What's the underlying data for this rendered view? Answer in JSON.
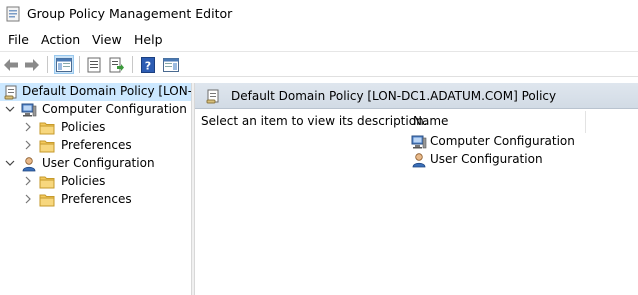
{
  "window": {
    "title": "Group Policy Management Editor",
    "icon": "gpo-editor-icon"
  },
  "menu": [
    "File",
    "Action",
    "View",
    "Help"
  ],
  "toolbar": {
    "buttons": [
      "back-arrow-icon",
      "forward-arrow-icon",
      "show-hide-console-tree-icon",
      "properties-icon",
      "export-list-icon",
      "help-icon",
      "show-hide-action-pane-icon"
    ]
  },
  "tree": {
    "root": "Default Domain Policy [LON-DC",
    "computer": {
      "label": "Computer Configuration",
      "children": [
        "Policies",
        "Preferences"
      ]
    },
    "user": {
      "label": "User Configuration",
      "children": [
        "Policies",
        "Preferences"
      ]
    }
  },
  "details": {
    "header": "Default Domain Policy [LON-DC1.ADATUM.COM] Policy",
    "description": "Select an item to view its description.",
    "column_name": "Name",
    "items": [
      "Computer Configuration",
      "User Configuration"
    ]
  },
  "colors": {
    "selection": "#cce8ff",
    "header_band": "#d8e0ea",
    "folder": "#f4c95d"
  }
}
